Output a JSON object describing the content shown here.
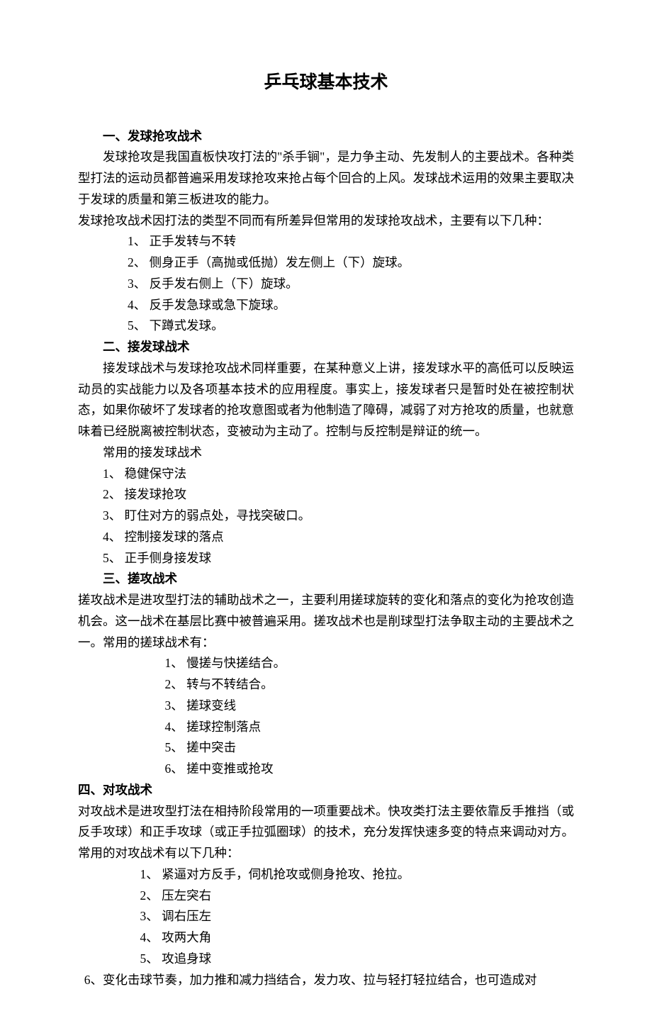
{
  "title": "乒乓球基本技术",
  "s1": {
    "heading": "一、发球抢攻战术",
    "p1": "发球抢攻是我国直板快攻打法的\"杀手锏\"，是力争主动、先发制人的主要战术。各种类型打法的运动员都普遍采用发球抢攻来抢占每个回合的上风。发球战术运用的效果主要取决于发球的质量和第三板进攻的能力。",
    "p2": "发球抢攻战术因打法的类型不同而有所差异但常用的发球抢攻战术，主要有以下几种：",
    "items": [
      "1、 正手发转与不转",
      "2、 侧身正手（高抛或低抛）发左侧上（下）旋球。",
      "3、 反手发右侧上（下）旋球。",
      "4、 反手发急球或急下旋球。",
      "5、 下蹲式发球。"
    ]
  },
  "s2": {
    "heading": "二、接发球战术",
    "p1": "接发球战术与发球抢攻战术同样重要，在某种意义上讲，接发球水平的高低可以反映运动员的实战能力以及各项基本技术的应用程度。事实上，接发球者只是暂时处在被控制状态，如果你破坏了发球者的抢攻意图或者为他制造了障碍，减弱了对方抢攻的质量，也就意味着已经脱离被控制状态，变被动为主动了。控制与反控制是辩证的统一。",
    "p2": "常用的接发球战术",
    "items": [
      "1、 稳健保守法",
      "2、 接发球抢攻",
      "3、 盯住对方的弱点处，寻找突破口。",
      "4、 控制接发球的落点",
      "5、 正手侧身接发球"
    ]
  },
  "s3": {
    "heading": "三、搓攻战术",
    "p1": "搓攻战术是进攻型打法的辅助战术之一，主要利用搓球旋转的变化和落点的变化为抢攻创造机会。这一战术在基层比赛中被普遍采用。搓攻战术也是削球型打法争取主动的主要战术之一。常用的搓球战术有：",
    "items": [
      "1、 慢搓与快搓结合。",
      "2、 转与不转结合。",
      "3、 搓球变线",
      "4、 搓球控制落点",
      "5、 搓中突击",
      "6、 搓中变推或抢攻"
    ]
  },
  "s4": {
    "heading": "四、对攻战术",
    "p1": "对攻战术是进攻型打法在相持阶段常用的一项重要战术。快攻类打法主要依靠反手推挡（或反手攻球）和正手攻球（或正手拉弧圈球）的技术，充分发挥快速多变的特点来调动对方。常用的对攻战术有以下几种：",
    "items": [
      "1、 紧逼对方反手，伺机抢攻或侧身抢攻、抢拉。",
      "2、 压左突右",
      " 3、 调右压左",
      "4、 攻两大角",
      "5、 攻追身球"
    ],
    "p2": "  6、变化击球节奏，加力推和减力挡结合，发力攻、拉与轻打轻拉结合，也可造成对"
  }
}
